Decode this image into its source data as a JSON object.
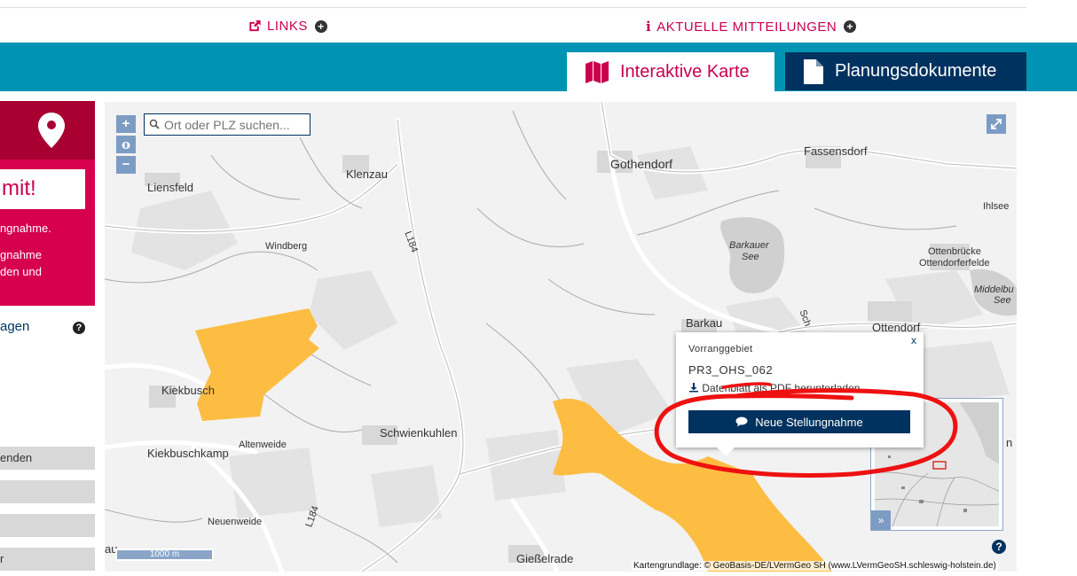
{
  "topnav": {
    "links_label": "LINKS",
    "news_label": "AKTUELLE MITTEILUNGEN"
  },
  "tabs": {
    "karte": "Interaktive Karte",
    "plan": "Planungsdokumente"
  },
  "left_panel": {
    "cta": "mit!",
    "line1": "ngnahme.",
    "line2": "gnahme",
    "line3": "den und",
    "link": "agen",
    "buttons": [
      "enden",
      "",
      "",
      "r"
    ]
  },
  "map": {
    "search_placeholder": "Ort oder PLZ suchen...",
    "zoom_in": "+",
    "zoom_reset": "o",
    "zoom_out": "−",
    "scale": "1000 m",
    "attribution": "Kartengrundlage: © GeoBasis-DE/LVermGeo SH (www.LVermGeoSH.schleswig-holstein.de)",
    "help": "?",
    "places": {
      "liensfeld": "Liensfeld",
      "klenzau": "Klenzau",
      "gothendorf": "Gothendorf",
      "fassensdorf": "Fassensdorf",
      "ihlsee": "Ihlsee",
      "windberg": "Windberg",
      "l184a": "L184",
      "barkauer1": "Barkauer",
      "barkauer2": "See",
      "ottenbruecke": "Ottenbrücke",
      "ottendorferfelde": "Ottendorferfelde",
      "middelburg1": "Middelbu",
      "middelburg2": "See",
      "barkau": "Barkau",
      "ottendorf": "Ottendorf",
      "kiekbusch": "Kiekbusch",
      "schwienkuhlen": "Schwienkuhlen",
      "altenweide": "Altenweide",
      "kiekbuschkamp": "Kiekbuschkamp",
      "neuenweide": "Neuenweide",
      "l184b": "L184",
      "giesselrade": "Gießelrade",
      "au": "au",
      "kirchn": "n",
      "sch": "Sch"
    }
  },
  "popup": {
    "close": "x",
    "title": "Vorranggebiet",
    "id": "PR3_OHS_062",
    "download": "Datenblatt als PDF herunterladen",
    "button": "Neue Stellungnahme"
  },
  "colors": {
    "magenta": "#c8004e",
    "teal": "#0093b4",
    "navy": "#00325f",
    "area": "#fcbd42"
  }
}
